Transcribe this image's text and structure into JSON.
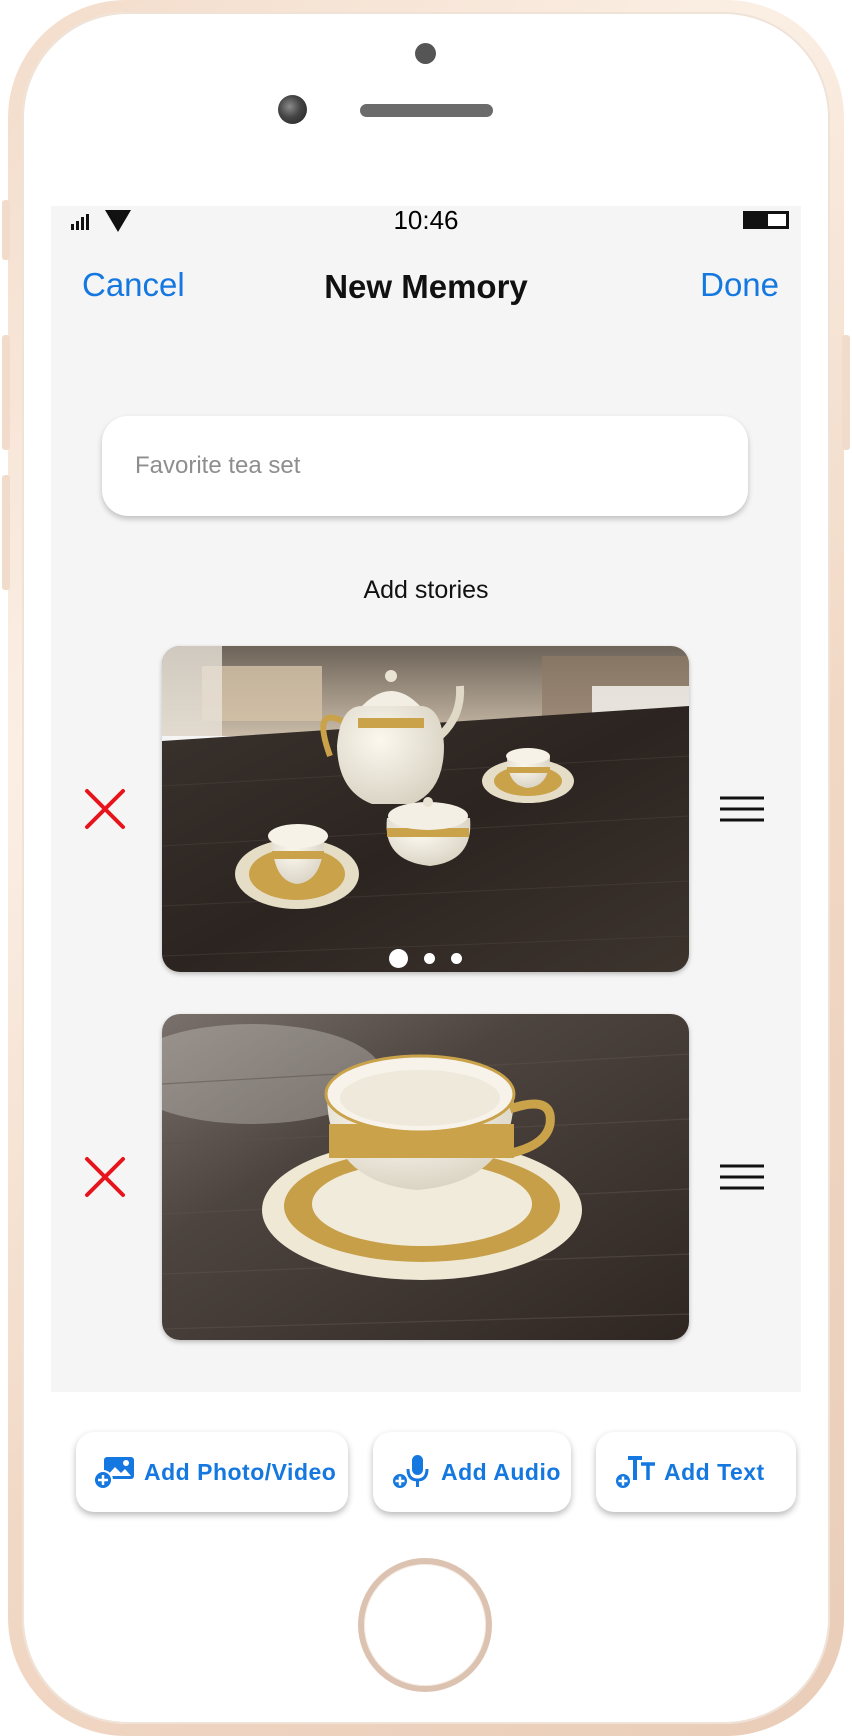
{
  "status_bar": {
    "time": "10:46"
  },
  "nav": {
    "cancel": "Cancel",
    "title": "New Memory",
    "done": "Done"
  },
  "title_field": {
    "placeholder": "Favorite tea set",
    "value": ""
  },
  "stories": {
    "label": "Add stories",
    "items": [
      {
        "image": "tea-set-photo",
        "page_count": 3,
        "active_page": 1
      },
      {
        "image": "teacup-photo"
      }
    ]
  },
  "toolbar": {
    "photo_label": "Add Photo/Video",
    "audio_label": "Add Audio",
    "text_label": "Add Text"
  },
  "colors": {
    "accent": "#1478e0",
    "delete": "#e8141c",
    "screen_bg": "#f5f5f5"
  },
  "icons": [
    "signal-icon",
    "wifi-icon",
    "battery-icon",
    "close-icon",
    "drag-handle-icon",
    "add-photo-icon",
    "add-audio-icon",
    "add-text-icon"
  ]
}
